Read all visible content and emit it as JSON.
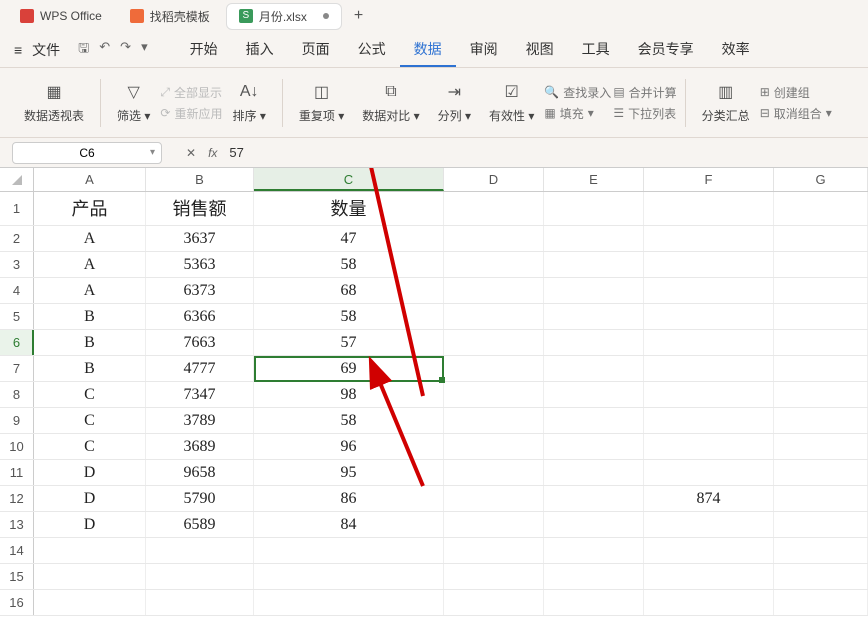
{
  "tabs": {
    "t0": "WPS Office",
    "t1": "找稻壳模板",
    "t2": "月份.xlsx",
    "xls_badge": "S",
    "plus": "+"
  },
  "menubar": {
    "file": "文件",
    "items": [
      "开始",
      "插入",
      "页面",
      "公式",
      "数据",
      "审阅",
      "视图",
      "工具",
      "会员专享",
      "效率"
    ],
    "active_index": 4
  },
  "ribbon": {
    "pivot": "数据透视表",
    "filter": "筛选",
    "showall": "全部显示",
    "reapply": "重新应用",
    "sort": "排序",
    "dup": "重复项",
    "compare": "数据对比",
    "split": "分列",
    "validate": "有效性",
    "lookup": "查找录入",
    "fill": "填充",
    "consolidate": "合并计算",
    "dropdown": "下拉列表",
    "subtotal": "分类汇总",
    "group": "创建组",
    "ungroup": "取消组合"
  },
  "formula_bar": {
    "cell_ref": "C6",
    "fx": "fx",
    "value": "57"
  },
  "columns": [
    "A",
    "B",
    "C",
    "D",
    "E",
    "F",
    "G"
  ],
  "headers": {
    "A": "产品",
    "B": "销售额",
    "C": "数量"
  },
  "rows": [
    {
      "A": "A",
      "B": "3637",
      "C": "47"
    },
    {
      "A": "A",
      "B": "5363",
      "C": "58"
    },
    {
      "A": "A",
      "B": "6373",
      "C": "68"
    },
    {
      "A": "B",
      "B": "6366",
      "C": "58"
    },
    {
      "A": "B",
      "B": "7663",
      "C": "57"
    },
    {
      "A": "B",
      "B": "4777",
      "C": "69"
    },
    {
      "A": "C",
      "B": "7347",
      "C": "98"
    },
    {
      "A": "C",
      "B": "3789",
      "C": "58"
    },
    {
      "A": "C",
      "B": "3689",
      "C": "96"
    },
    {
      "A": "D",
      "B": "9658",
      "C": "95"
    },
    {
      "A": "D",
      "B": "5790",
      "C": "86",
      "F": "874"
    },
    {
      "A": "D",
      "B": "6589",
      "C": "84"
    },
    {
      "A": "",
      "B": "",
      "C": ""
    },
    {
      "A": "",
      "B": "",
      "C": ""
    }
  ],
  "selection": {
    "col": "C",
    "row": 6
  }
}
